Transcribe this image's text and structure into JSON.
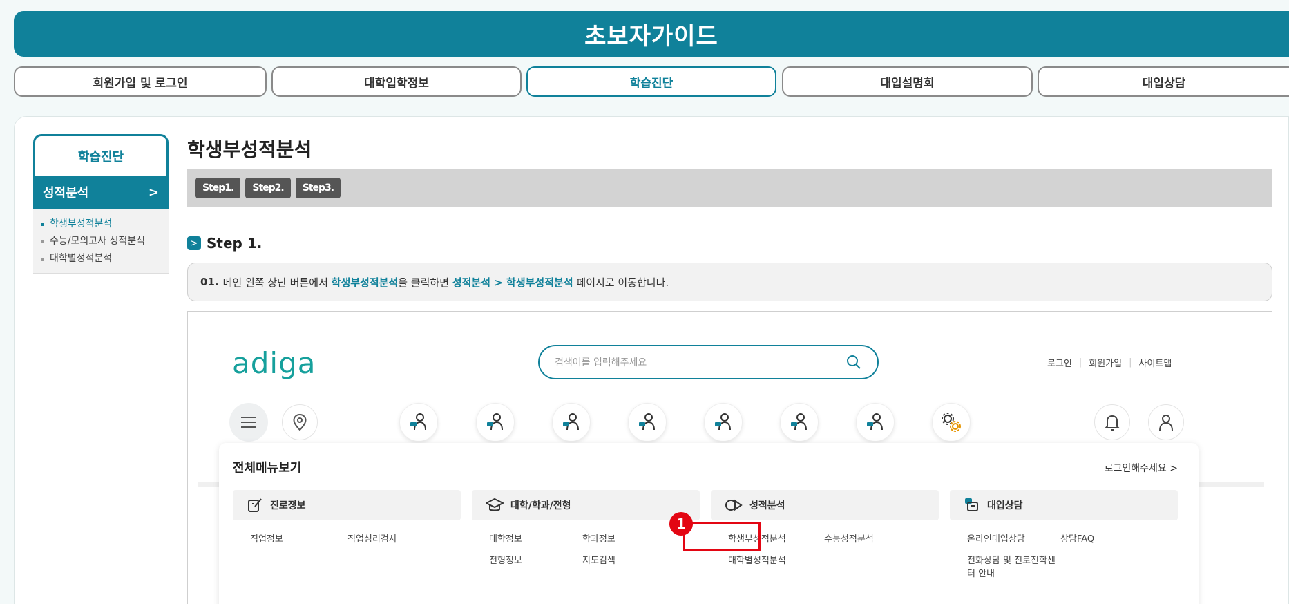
{
  "banner": {
    "title": "초보자가이드"
  },
  "topnav": {
    "tabs": [
      "회원가입 및 로그인",
      "대학입학정보",
      "학습진단",
      "대입설명회",
      "대입상담"
    ],
    "active": "학습진단"
  },
  "lnb": {
    "header": "학습진단",
    "selected": "성적분석",
    "selected_arrow": ">",
    "items": [
      "학생부성적분석",
      "수능/모의고사 성적분석",
      "대학별성적분석"
    ]
  },
  "content": {
    "title": "학생부성적분석",
    "steps": [
      "Step1.",
      "Step2.",
      "Step3."
    ],
    "step_heading": "Step 1.",
    "step_icon": ">",
    "instruction": {
      "num": "01.",
      "part1": "메인 왼쪽 상단 버튼에서 ",
      "hl1": "학생부성적분석",
      "part2": "을 클릭하면 ",
      "hl2": "성적분석 > 학생부성적분석",
      "part3": " 페이지로 이동합니다."
    }
  },
  "screenshot": {
    "logo": "adiga",
    "search_placeholder": "검색어를 입력해주세요",
    "util": [
      "로그인",
      "회원가입",
      "사이트맵"
    ],
    "menu_title": "전체메뉴보기",
    "login_prompt": "로그인해주세요 >",
    "categories": [
      {
        "label": "진로정보",
        "icon": "pencil-note-icon",
        "links": [
          "직업정보",
          "직업심리검사"
        ]
      },
      {
        "label": "대학/학과/전형",
        "icon": "graduation-cap-icon",
        "links": [
          "대학정보",
          "학과정보",
          "전형정보",
          "지도검색"
        ]
      },
      {
        "label": "성적분석",
        "icon": "analysis-icon",
        "links": [
          "학생부성적분석",
          "수능성적분석",
          "대학별성적분석"
        ]
      },
      {
        "label": "대입상담",
        "icon": "consult-icon",
        "links": [
          "온라인대입상담",
          "상담FAQ",
          "전화상담 및 진로진학센",
          "터 안내"
        ]
      }
    ],
    "callout_number": "1",
    "colors": {
      "primary": "#10819a",
      "highlight": "#e30613",
      "logo": "#16a09c"
    }
  }
}
